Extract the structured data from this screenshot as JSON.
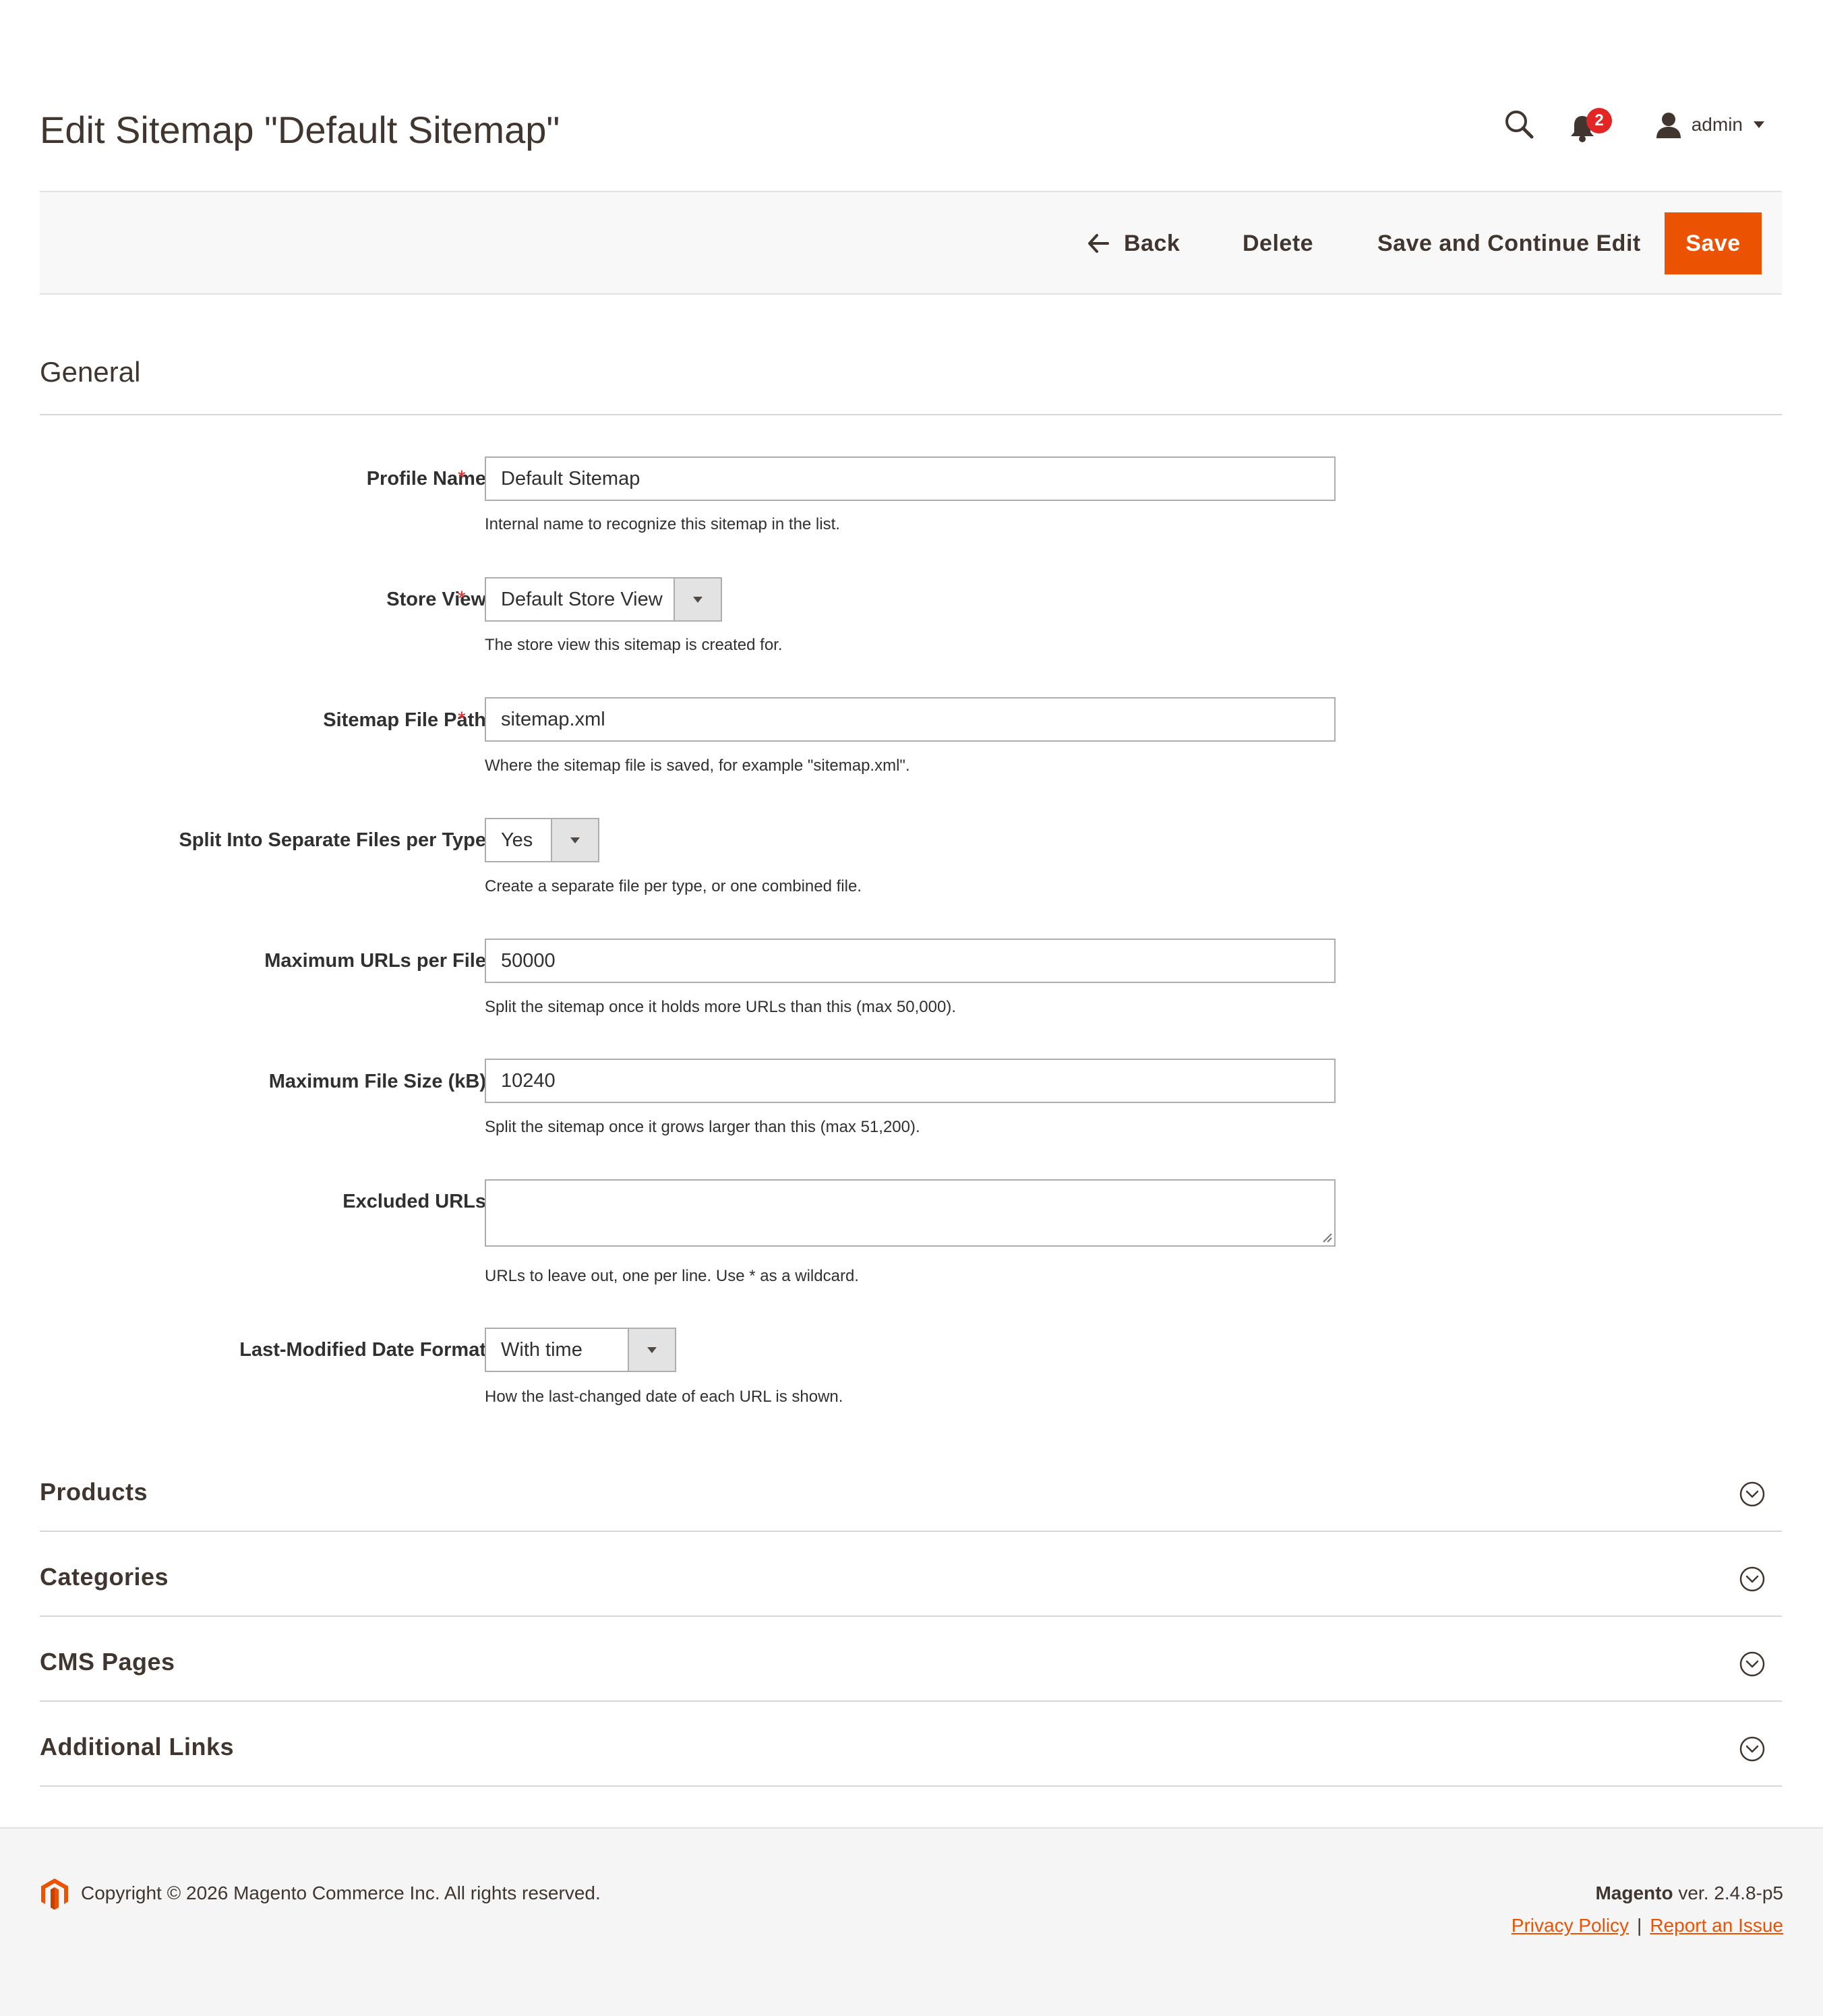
{
  "header": {
    "title": "Edit Sitemap \"Default Sitemap\"",
    "notifications_count": "2",
    "user_name": "admin"
  },
  "actions": {
    "back": "Back",
    "delete": "Delete",
    "save_continue": "Save and Continue Edit",
    "save": "Save"
  },
  "general": {
    "title": "General",
    "required_marker": "*",
    "fields": {
      "profile_name": {
        "label": "Profile Name",
        "value": "Default Sitemap",
        "note": "Internal name to recognize this sitemap in the list."
      },
      "store_view": {
        "label": "Store View",
        "value": "Default Store View",
        "note": "The store view this sitemap is created for."
      },
      "file_path": {
        "label": "Sitemap File Path",
        "value": "sitemap.xml",
        "note": "Where the sitemap file is saved, for example \"sitemap.xml\"."
      },
      "split_files": {
        "label": "Split Into Separate Files per Type",
        "value": "Yes",
        "note": "Create a separate file per type, or one combined file."
      },
      "max_urls": {
        "label": "Maximum URLs per File",
        "value": "50000",
        "note": "Split the sitemap once it holds more URLs than this (max 50,000)."
      },
      "max_size": {
        "label": "Maximum File Size (kB)",
        "value": "10240",
        "note": "Split the sitemap once it grows larger than this (max 51,200)."
      },
      "excluded_urls": {
        "label": "Excluded URLs",
        "value": "",
        "note": "URLs to leave out, one per line. Use * as a wildcard."
      },
      "date_format": {
        "label": "Last-Modified Date Format",
        "value": "With time",
        "note": "How the last-changed date of each URL is shown."
      }
    }
  },
  "sections": [
    "Products",
    "Categories",
    "CMS Pages",
    "Additional Links"
  ],
  "footer": {
    "copyright": "Copyright © 2026 Magento Commerce Inc. All rights reserved.",
    "brand": "Magento",
    "version": " ver. 2.4.8-p5",
    "privacy": "Privacy Policy",
    "separator": "|",
    "report": "Report an Issue"
  },
  "colors": {
    "accent": "#eb5202",
    "required": "#e22626",
    "title_text": "#41362f"
  },
  "icons": {
    "search": "search-icon",
    "bell": "bell-icon",
    "user": "user-icon",
    "back": "arrow-left-icon",
    "expand": "chevron-down-circle-icon",
    "logo": "magento-logo-icon"
  }
}
